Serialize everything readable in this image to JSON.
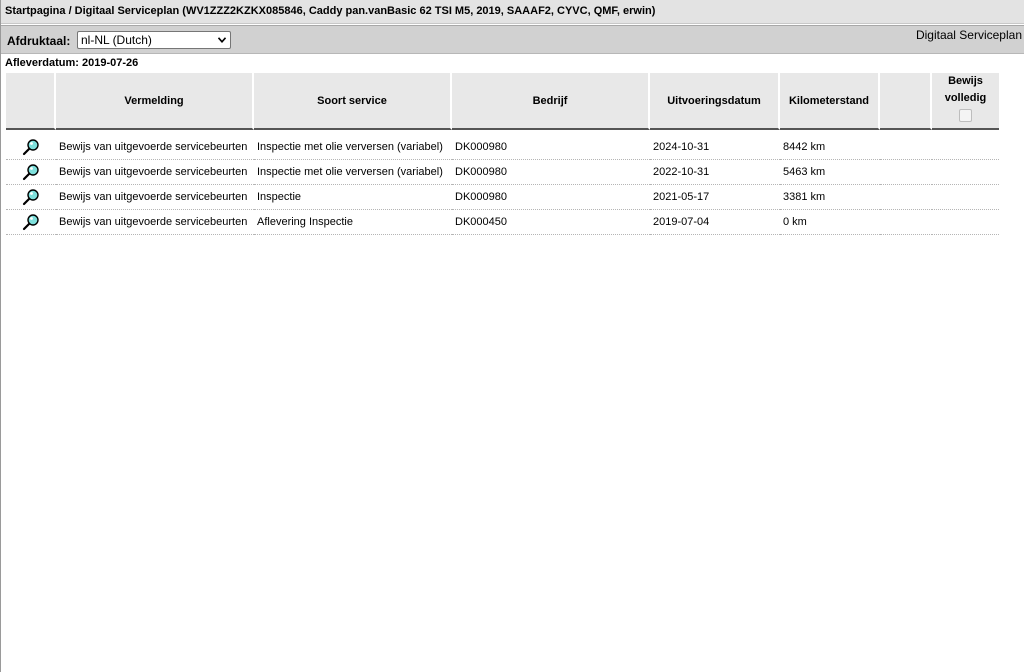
{
  "header": {
    "breadcrumb": "Startpagina / Digitaal Serviceplan (WV1ZZZ2KZKX085846, Caddy pan.vanBasic 62 TSI M5, 2019, SAAAF2, CYVC, QMF, erwin)"
  },
  "toolbar": {
    "language_label": "Afdruktaal:",
    "language_selected": "nl-NL (Dutch)",
    "page_heading": "Digitaal Serviceplan"
  },
  "delivery": "Afleverdatum: 2019-07-26",
  "table": {
    "columns": {
      "entry": "Vermelding",
      "service_type": "Soort service",
      "company": "Bedrijf",
      "date": "Uitvoeringsdatum",
      "mileage": "Kilometerstand",
      "proof_line1": "Bewijs",
      "proof_line2": "volledig"
    },
    "rows": [
      {
        "entry": "Bewijs van uitgevoerde servicebeurten",
        "service_type": "Inspectie met olie verversen (variabel)",
        "company": "DK000980",
        "date": "2024-10-31",
        "mileage": "8442 km"
      },
      {
        "entry": "Bewijs van uitgevoerde servicebeurten",
        "service_type": "Inspectie met olie verversen (variabel)",
        "company": "DK000980",
        "date": "2022-10-31",
        "mileage": "5463 km"
      },
      {
        "entry": "Bewijs van uitgevoerde servicebeurten",
        "service_type": "Inspectie",
        "company": "DK000980",
        "date": "2021-05-17",
        "mileage": "3381 km"
      },
      {
        "entry": "Bewijs van uitgevoerde servicebeurten",
        "service_type": "Aflevering Inspectie",
        "company": "DK000450",
        "date": "2019-07-04",
        "mileage": "0 km"
      }
    ]
  },
  "icons": {
    "row_action": "magnifier-icon",
    "select_chevron": "chevron-down-icon"
  },
  "colors": {
    "title_bar": "#e3e3e3",
    "toolbar": "#d1d1d1",
    "header_cell": "#e8e8e8",
    "magnifier_lens": "#7fe0dc"
  }
}
